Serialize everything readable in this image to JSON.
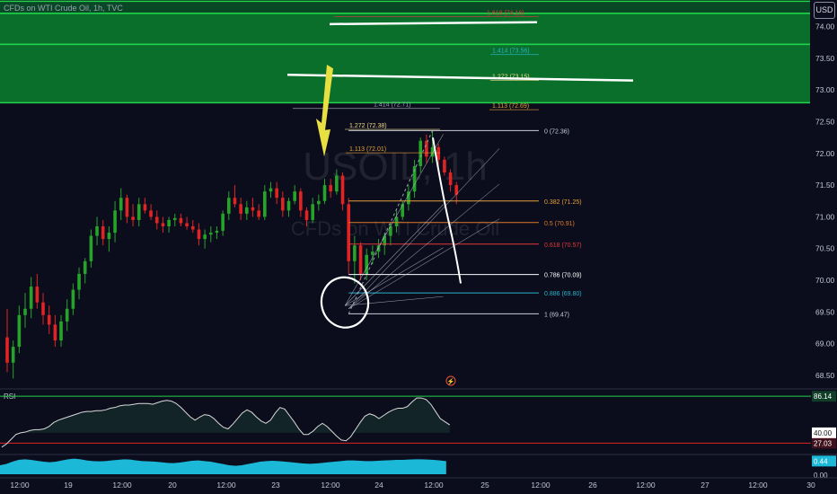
{
  "header": {
    "title": "CFDs on WTI Crude Oil, 1h, TVC",
    "currency": "USD"
  },
  "watermark": {
    "symbol": "USOIL, 1h",
    "name": "CFDs on WTI Crude Oil"
  },
  "colors": {
    "background": "#0b0d1c",
    "bull": "#26a42a",
    "bear": "#e02424",
    "zone_fill": "#0a7a2e",
    "zone_line": "#22d34a",
    "fib_base": "#c9cdd8",
    "rsi_line": "#d9d9d9",
    "rsi_fill": "#2a6b4c",
    "lower_fill": "#1bb8d8",
    "annotation": "#ffffff",
    "arrow": "#e8e040"
  },
  "chart_data": [
    {
      "type": "candlestick",
      "title": "",
      "timeframe": "1h",
      "y_axis": {
        "ylim": [
          68.3,
          74.42
        ],
        "ticks": [
          "74.00",
          "73.50",
          "73.00",
          "72.50",
          "72.00",
          "71.50",
          "71.00",
          "70.50",
          "70.00",
          "69.50",
          "69.00",
          "68.50"
        ]
      },
      "x_axis": {
        "ticks": [
          "12:00",
          "19",
          "12:00",
          "20",
          "12:00",
          "23",
          "12:00",
          "24",
          "12:00",
          "25",
          "12:00",
          "26",
          "12:00",
          "27",
          "12:00",
          "30"
        ]
      },
      "ohlc": [
        [
          69.1,
          69.55,
          68.55,
          68.7
        ],
        [
          68.7,
          69.05,
          68.45,
          68.95
        ],
        [
          68.95,
          69.6,
          68.85,
          69.45
        ],
        [
          69.45,
          69.8,
          69.25,
          69.55
        ],
        [
          69.55,
          70.05,
          69.4,
          69.9
        ],
        [
          69.9,
          70.1,
          69.55,
          69.65
        ],
        [
          69.65,
          69.8,
          69.3,
          69.45
        ],
        [
          69.45,
          69.6,
          69.15,
          69.3
        ],
        [
          69.3,
          69.45,
          68.95,
          69.05
        ],
        [
          69.05,
          69.45,
          68.95,
          69.35
        ],
        [
          69.35,
          69.7,
          69.2,
          69.55
        ],
        [
          69.55,
          69.95,
          69.45,
          69.85
        ],
        [
          69.85,
          70.2,
          69.7,
          70.1
        ],
        [
          70.1,
          70.35,
          69.95,
          70.3
        ],
        [
          70.3,
          70.8,
          70.2,
          70.7
        ],
        [
          70.7,
          71.0,
          70.55,
          70.85
        ],
        [
          70.85,
          70.95,
          70.55,
          70.65
        ],
        [
          70.65,
          70.85,
          70.45,
          70.75
        ],
        [
          70.75,
          71.25,
          70.6,
          71.1
        ],
        [
          71.1,
          71.45,
          70.95,
          71.3
        ],
        [
          71.3,
          71.35,
          70.9,
          71.0
        ],
        [
          71.0,
          71.2,
          70.85,
          70.95
        ],
        [
          70.95,
          71.3,
          70.85,
          71.2
        ],
        [
          71.2,
          71.3,
          71.05,
          71.1
        ],
        [
          71.1,
          71.2,
          70.95,
          71.0
        ],
        [
          71.0,
          71.1,
          70.8,
          70.9
        ],
        [
          70.9,
          71.0,
          70.75,
          70.85
        ],
        [
          70.85,
          71.0,
          70.75,
          70.95
        ],
        [
          70.95,
          71.05,
          70.85,
          70.98
        ],
        [
          70.98,
          71.05,
          70.85,
          70.9
        ],
        [
          70.9,
          71.0,
          70.8,
          70.85
        ],
        [
          70.85,
          70.95,
          70.75,
          70.8
        ],
        [
          70.8,
          70.9,
          70.55,
          70.65
        ],
        [
          70.65,
          70.8,
          70.5,
          70.72
        ],
        [
          70.72,
          70.85,
          70.6,
          70.75
        ],
        [
          70.75,
          70.85,
          70.65,
          70.78
        ],
        [
          70.78,
          71.1,
          70.7,
          71.05
        ],
        [
          71.05,
          71.4,
          70.95,
          71.3
        ],
        [
          71.3,
          71.5,
          71.15,
          71.2
        ],
        [
          71.2,
          71.3,
          70.95,
          71.05
        ],
        [
          71.05,
          71.25,
          70.95,
          71.15
        ],
        [
          71.15,
          71.3,
          71.0,
          71.1
        ],
        [
          71.1,
          71.2,
          70.95,
          71.0
        ],
        [
          71.0,
          71.5,
          70.95,
          71.4
        ],
        [
          71.4,
          71.55,
          71.3,
          71.45
        ],
        [
          71.45,
          71.55,
          71.2,
          71.3
        ],
        [
          71.3,
          71.4,
          71.0,
          71.1
        ],
        [
          71.1,
          71.3,
          71.0,
          71.25
        ],
        [
          71.25,
          71.5,
          71.2,
          71.4
        ],
        [
          71.4,
          71.45,
          71.0,
          71.1
        ],
        [
          71.1,
          71.15,
          70.85,
          70.95
        ],
        [
          70.95,
          71.3,
          70.9,
          71.2
        ],
        [
          71.2,
          71.35,
          71.1,
          71.25
        ],
        [
          71.25,
          71.6,
          71.2,
          71.5
        ],
        [
          71.5,
          71.6,
          71.3,
          71.4
        ],
        [
          71.4,
          71.75,
          71.35,
          71.65
        ],
        [
          71.65,
          71.7,
          71.1,
          71.2
        ],
        [
          71.2,
          71.3,
          70.1,
          70.3
        ],
        [
          70.3,
          70.7,
          69.95,
          70.55
        ],
        [
          70.55,
          70.6,
          70.0,
          70.1
        ],
        [
          70.1,
          70.5,
          70.0,
          70.4
        ],
        [
          70.4,
          70.55,
          70.25,
          70.45
        ],
        [
          70.45,
          70.65,
          70.35,
          70.55
        ],
        [
          70.55,
          70.75,
          70.4,
          70.7
        ],
        [
          70.7,
          70.9,
          70.55,
          70.85
        ],
        [
          70.85,
          71.1,
          70.75,
          71.0
        ],
        [
          71.0,
          71.25,
          70.95,
          71.2
        ],
        [
          71.2,
          71.5,
          71.1,
          71.4
        ],
        [
          71.4,
          71.9,
          71.3,
          71.8
        ],
        [
          71.8,
          72.25,
          71.7,
          72.2
        ],
        [
          72.2,
          72.3,
          71.85,
          71.95
        ],
        [
          71.95,
          72.36,
          71.85,
          72.1
        ],
        [
          72.1,
          72.15,
          71.8,
          71.9
        ],
        [
          71.9,
          71.95,
          71.65,
          71.7
        ],
        [
          71.7,
          71.75,
          71.4,
          71.5
        ],
        [
          71.5,
          71.55,
          71.2,
          71.35
        ]
      ],
      "fibonacci": {
        "lower": [
          {
            "label": "0 (72.36)",
            "price": 72.36,
            "color": "#c9cdd8"
          },
          {
            "label": "0.382 (71.25)",
            "price": 71.25,
            "color": "#e8a23a"
          },
          {
            "label": "0.5 (70.91)",
            "price": 70.91,
            "color": "#e07a2a"
          },
          {
            "label": "0.618 (70.57)",
            "price": 70.57,
            "color": "#e23a3a"
          },
          {
            "label": "0.786 (70.09)",
            "price": 70.09,
            "color": "#ffffff"
          },
          {
            "label": "0.886 (69.80)",
            "price": 69.8,
            "color": "#27b3c8"
          },
          {
            "label": "1 (69.47)",
            "price": 69.47,
            "color": "#c9cdd8"
          }
        ],
        "upper": [
          {
            "label": "1.113 (72.01)",
            "price": 72.01,
            "color": "#e8a23a"
          },
          {
            "label": "1.272 (72.38)",
            "price": 72.38,
            "color": "#f0d98a"
          },
          {
            "label": "1.414 (72.71)",
            "price": 72.71,
            "color": "#9aa0b4"
          },
          {
            "label": "1.113 (72.69)",
            "price": 72.69,
            "color": "#e8a23a"
          },
          {
            "label": "1.272 (73.15)",
            "price": 73.15,
            "color": "#f0d98a"
          },
          {
            "label": "1.414 (73.56)",
            "price": 73.56,
            "color": "#27b3c8"
          },
          {
            "label": "1.618 (74.16)",
            "price": 74.16,
            "color": "#e23a3a"
          }
        ]
      },
      "zones": [
        {
          "top": 74.4,
          "bottom": 74.21
        },
        {
          "top": 74.21,
          "bottom": 73.72
        },
        {
          "top": 73.72,
          "bottom": 72.8
        }
      ]
    },
    {
      "type": "line",
      "title": "RSI",
      "ylim": [
        15,
        92
      ],
      "levels": [
        86.14,
        40.0,
        27.03
      ],
      "tick_labels": [
        "86.14",
        "40.00",
        "27.03"
      ],
      "values": [
        22,
        26,
        32,
        38,
        40,
        41,
        43,
        44,
        44,
        45,
        48,
        53,
        56,
        58,
        60,
        62,
        64,
        66,
        67,
        67,
        68,
        68,
        69,
        71,
        72,
        74,
        75,
        75,
        76,
        77,
        77,
        77,
        76,
        78,
        80,
        81,
        80,
        77,
        72,
        66,
        60,
        56,
        60,
        63,
        62,
        58,
        52,
        47,
        45,
        51,
        58,
        65,
        69,
        66,
        60,
        55,
        52,
        56,
        65,
        72,
        70,
        62,
        54,
        45,
        38,
        38,
        42,
        48,
        52,
        48,
        42,
        36,
        31,
        30,
        35,
        44,
        53,
        61,
        64,
        62,
        58,
        62,
        66,
        69,
        71,
        71,
        73,
        79,
        84,
        84,
        82,
        76,
        67,
        58,
        54,
        50
      ]
    },
    {
      "type": "area",
      "title": "",
      "ylim": [
        0,
        0.6
      ],
      "tick_labels": [
        "0.44",
        "0.00"
      ],
      "values": [
        0.3,
        0.34,
        0.42,
        0.48,
        0.5,
        0.48,
        0.45,
        0.42,
        0.4,
        0.42,
        0.46,
        0.5,
        0.52,
        0.5,
        0.46,
        0.44,
        0.43,
        0.44,
        0.46,
        0.48,
        0.5,
        0.49,
        0.46,
        0.44,
        0.43,
        0.42,
        0.4,
        0.38,
        0.37,
        0.39,
        0.42,
        0.45,
        0.46,
        0.44,
        0.42,
        0.38,
        0.34,
        0.3,
        0.28,
        0.3,
        0.34,
        0.38,
        0.42,
        0.44,
        0.45,
        0.44,
        0.42,
        0.4,
        0.38,
        0.36,
        0.35,
        0.36,
        0.38,
        0.4,
        0.42,
        0.44,
        0.46,
        0.46,
        0.45,
        0.44,
        0.44,
        0.45,
        0.46,
        0.47,
        0.48,
        0.48,
        0.49,
        0.5,
        0.5,
        0.49,
        0.48,
        0.46,
        0.44
      ]
    }
  ]
}
